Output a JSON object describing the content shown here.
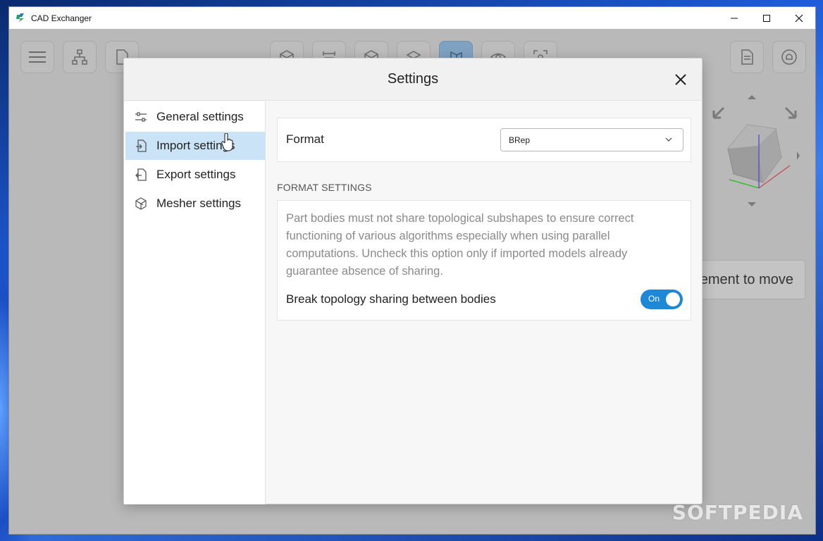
{
  "window": {
    "title": "CAD Exchanger"
  },
  "background": {
    "hint_text": "ement to move"
  },
  "dialog": {
    "title": "Settings",
    "nav": [
      {
        "label": "General settings",
        "icon": "sliders-icon"
      },
      {
        "label": "Import settings",
        "icon": "import-file-icon",
        "selected": true
      },
      {
        "label": "Export settings",
        "icon": "export-file-icon"
      },
      {
        "label": "Mesher settings",
        "icon": "mesh-cube-icon"
      }
    ],
    "format": {
      "label": "Format",
      "selected": "BRep"
    },
    "section_title": "FORMAT SETTINGS",
    "option": {
      "description": "Part bodies must not share topological subshapes to ensure correct functioning of various algorithms especially when using parallel computations. Uncheck this option only if imported models already guarantee absence of sharing.",
      "label": "Break topology sharing between bodies",
      "toggle_state": "On"
    }
  },
  "watermark": "SOFTPEDIA",
  "colors": {
    "accent": "#1e88d8",
    "selected_nav": "#cbe3f6"
  }
}
